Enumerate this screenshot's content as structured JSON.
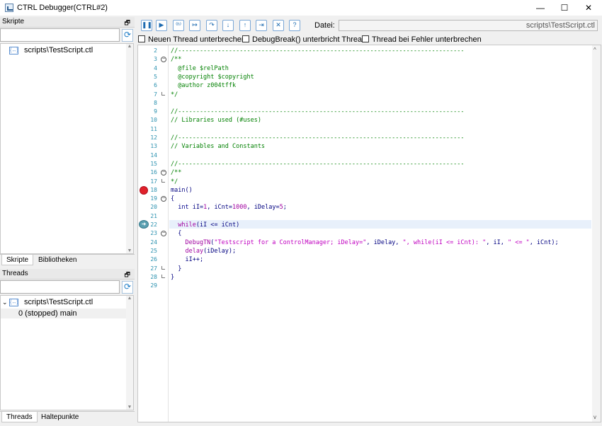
{
  "window": {
    "title": "CTRL Debugger(CTRL#2)",
    "minimize": "—",
    "maximize": "☐",
    "close": "✕"
  },
  "scripts_panel": {
    "title": "Skripte",
    "items": [
      "scripts\\TestScript.ctl"
    ],
    "tabs": [
      "Skripte",
      "Bibliotheken"
    ]
  },
  "threads_panel": {
    "title": "Threads",
    "script": "scripts\\TestScript.ctl",
    "thread": "0 (stopped) main",
    "tabs": [
      "Threads",
      "Haltepunkte"
    ]
  },
  "toolbar": {
    "icons": [
      "pause-icon",
      "play-icon",
      "step-icon",
      "run-to-icon",
      "step-over-icon",
      "step-into-icon",
      "step-out-icon",
      "jump-icon",
      "stop-icon",
      "help-icon"
    ],
    "file_label": "Datei:",
    "file_value": "scripts\\TestScript.ctl"
  },
  "options": {
    "new_thread": "Neuen Thread unterbrechen",
    "debugbreak": "DebugBreak() unterbricht Thread",
    "on_error": "Thread bei Fehler unterbrechen"
  },
  "code": {
    "breakpoint_line": 18,
    "current_line": 22,
    "lines": [
      {
        "n": "2",
        "fold": "",
        "segs": [
          [
            "c-comment",
            "//-------------------------------------------------------------------------------"
          ]
        ]
      },
      {
        "n": "3",
        "fold": "open",
        "segs": [
          [
            "c-comment",
            "/**"
          ]
        ]
      },
      {
        "n": "4",
        "fold": "",
        "segs": [
          [
            "c-comment",
            "  @file $relPath"
          ]
        ]
      },
      {
        "n": "5",
        "fold": "",
        "segs": [
          [
            "c-comment",
            "  @copyright $copyright"
          ]
        ]
      },
      {
        "n": "6",
        "fold": "",
        "segs": [
          [
            "c-comment",
            "  @author z004tffk"
          ]
        ]
      },
      {
        "n": "7",
        "fold": "end",
        "segs": [
          [
            "c-comment",
            "*/"
          ]
        ]
      },
      {
        "n": "8",
        "fold": "",
        "segs": []
      },
      {
        "n": "9",
        "fold": "",
        "segs": [
          [
            "c-comment",
            "//-------------------------------------------------------------------------------"
          ]
        ]
      },
      {
        "n": "10",
        "fold": "",
        "segs": [
          [
            "c-comment",
            "// Libraries used (#uses)"
          ]
        ]
      },
      {
        "n": "11",
        "fold": "",
        "segs": []
      },
      {
        "n": "12",
        "fold": "",
        "segs": [
          [
            "c-comment",
            "//-------------------------------------------------------------------------------"
          ]
        ]
      },
      {
        "n": "13",
        "fold": "",
        "segs": [
          [
            "c-comment",
            "// Variables and Constants"
          ]
        ]
      },
      {
        "n": "14",
        "fold": "",
        "segs": []
      },
      {
        "n": "15",
        "fold": "",
        "segs": [
          [
            "c-comment",
            "//-------------------------------------------------------------------------------"
          ]
        ]
      },
      {
        "n": "16",
        "fold": "open",
        "segs": [
          [
            "c-comment",
            "/**"
          ]
        ]
      },
      {
        "n": "17",
        "fold": "end",
        "segs": [
          [
            "c-comment",
            "*/"
          ]
        ]
      },
      {
        "n": "18",
        "fold": "",
        "segs": [
          [
            "c-plain",
            "main()"
          ]
        ]
      },
      {
        "n": "19",
        "fold": "open",
        "segs": [
          [
            "c-plain",
            "{"
          ]
        ]
      },
      {
        "n": "20",
        "fold": "",
        "segs": [
          [
            "c-kw",
            "  int "
          ],
          [
            "c-plain",
            "iI="
          ],
          [
            "c-num",
            "1"
          ],
          [
            "c-plain",
            ", iCnt="
          ],
          [
            "c-num",
            "1000"
          ],
          [
            "c-plain",
            ", iDelay="
          ],
          [
            "c-num",
            "5"
          ],
          [
            "c-plain",
            ";"
          ]
        ]
      },
      {
        "n": "21",
        "fold": "",
        "segs": []
      },
      {
        "n": "22",
        "fold": "",
        "segs": [
          [
            "c-fn",
            "  while"
          ],
          [
            "c-plain",
            "(iI <= iCnt)"
          ]
        ]
      },
      {
        "n": "23",
        "fold": "open",
        "segs": [
          [
            "c-plain",
            "  {"
          ]
        ]
      },
      {
        "n": "24",
        "fold": "",
        "segs": [
          [
            "c-fn",
            "    DebugTN"
          ],
          [
            "c-plain",
            "("
          ],
          [
            "c-str",
            "\"Testscript for a ControlManager; iDelay=\""
          ],
          [
            "c-plain",
            ", iDelay, "
          ],
          [
            "c-str",
            "\", while(iI <= iCnt): \""
          ],
          [
            "c-plain",
            ", iI, "
          ],
          [
            "c-str",
            "\" <= \""
          ],
          [
            "c-plain",
            ", iCnt);"
          ]
        ]
      },
      {
        "n": "25",
        "fold": "",
        "segs": [
          [
            "c-fn",
            "    delay"
          ],
          [
            "c-plain",
            "(iDelay);"
          ]
        ]
      },
      {
        "n": "26",
        "fold": "",
        "segs": [
          [
            "c-plain",
            "    iI++;"
          ]
        ]
      },
      {
        "n": "27",
        "fold": "end",
        "segs": [
          [
            "c-plain",
            "  }"
          ]
        ]
      },
      {
        "n": "28",
        "fold": "end",
        "segs": [
          [
            "c-plain",
            "}"
          ]
        ]
      },
      {
        "n": "29",
        "fold": "",
        "segs": []
      }
    ]
  }
}
